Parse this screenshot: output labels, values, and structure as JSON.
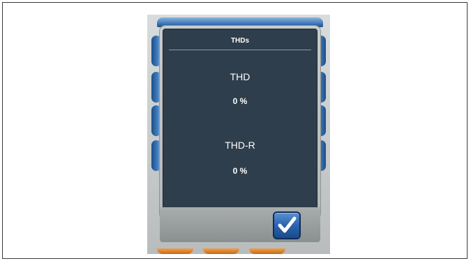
{
  "dialog": {
    "title": "THDs",
    "metrics": [
      {
        "label": "THD",
        "value": "0 %"
      },
      {
        "label": "THD-R",
        "value": "0 %"
      }
    ],
    "confirm_icon": "checkmark-icon"
  },
  "colors": {
    "dialog_background": "#2e3e4c",
    "tab_blue": "#3f7bbd",
    "tab_orange": "#e08a35",
    "confirm_button": "#2a63b0"
  }
}
